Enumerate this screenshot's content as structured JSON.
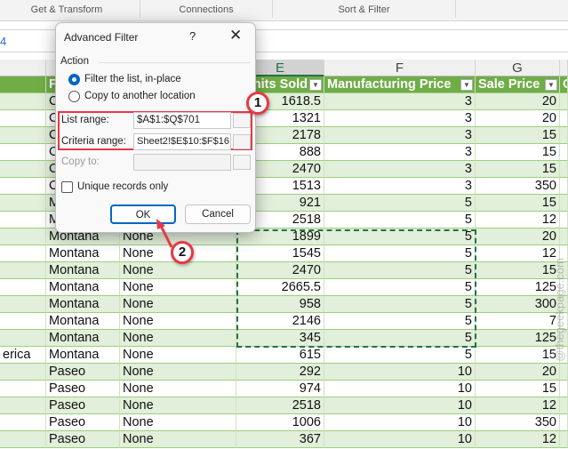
{
  "ribbon": {
    "groups": [
      "Get & Transform",
      "Connections",
      "Sort & Filter"
    ]
  },
  "formula_bar": {
    "name_box_fragment": "4"
  },
  "columns": {
    "letters": [
      "E",
      "F",
      "G"
    ]
  },
  "headers": {
    "b": "F",
    "e": "Units Sold",
    "f": "Manufacturing Price",
    "g": "Sale Price",
    "h": "C"
  },
  "rows": [
    [
      "",
      "C",
      "",
      "1618.5",
      "3",
      "20"
    ],
    [
      "",
      "C",
      "",
      "1321",
      "3",
      "20"
    ],
    [
      "",
      "C",
      "",
      "2178",
      "3",
      "15"
    ],
    [
      "",
      "C",
      "",
      "888",
      "3",
      "15"
    ],
    [
      "",
      "C",
      "",
      "2470",
      "3",
      "15"
    ],
    [
      "",
      "C",
      "",
      "1513",
      "3",
      "350"
    ],
    [
      "",
      "M",
      "",
      "921",
      "5",
      "15"
    ],
    [
      "",
      "M",
      "",
      "2518",
      "5",
      "12"
    ],
    [
      "",
      "Montana",
      "None",
      "1899",
      "5",
      "20"
    ],
    [
      "",
      "Montana",
      "None",
      "1545",
      "5",
      "12"
    ],
    [
      "",
      "Montana",
      "None",
      "2470",
      "5",
      "15"
    ],
    [
      "",
      "Montana",
      "None",
      "2665.5",
      "5",
      "125"
    ],
    [
      "",
      "Montana",
      "None",
      "958",
      "5",
      "300"
    ],
    [
      "",
      "Montana",
      "None",
      "2146",
      "5",
      "7"
    ],
    [
      "",
      "Montana",
      "None",
      "345",
      "5",
      "125"
    ],
    [
      "erica",
      "Montana",
      "None",
      "615",
      "5",
      "15"
    ],
    [
      "",
      "Paseo",
      "None",
      "292",
      "10",
      "20"
    ],
    [
      "",
      "Paseo",
      "None",
      "974",
      "10",
      "15"
    ],
    [
      "",
      "Paseo",
      "None",
      "2518",
      "10",
      "12"
    ],
    [
      "",
      "Paseo",
      "None",
      "1006",
      "10",
      "350"
    ],
    [
      "",
      "Paseo",
      "None",
      "367",
      "10",
      "12"
    ]
  ],
  "dialog": {
    "title": "Advanced Filter",
    "help": "?",
    "action_label": "Action",
    "radio_filter": "Filter the list, in-place",
    "radio_copy": "Copy to another location",
    "list_range_label": "List range:",
    "list_range_value": "$A$1:$Q$701",
    "criteria_label": "Criteria range:",
    "criteria_value": "Sheet2!$E$10:$F$16",
    "copy_to_label": "Copy to:",
    "copy_to_value": "",
    "unique_label": "Unique records only",
    "ok": "OK",
    "cancel": "Cancel"
  },
  "callouts": [
    "1",
    "2"
  ],
  "watermark": "@thegeekpage.com",
  "colors": {
    "header_green": "#70ad47",
    "band_green": "#e2efda",
    "highlight_red": "#e53945",
    "ok_blue": "#0067c0"
  }
}
